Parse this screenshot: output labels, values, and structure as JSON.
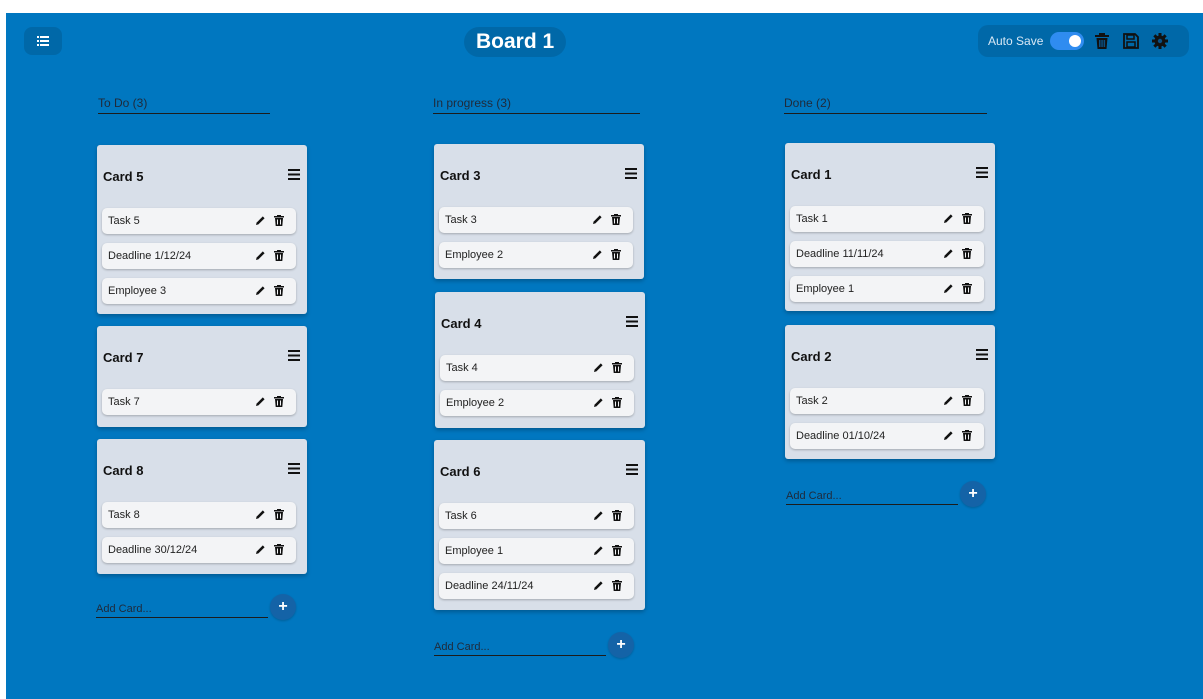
{
  "app": {
    "board_title": "Board 1"
  },
  "toolbar": {
    "autosave_label": "Auto Save",
    "autosave_enabled": true,
    "icons": [
      "list-icon",
      "trash-icon",
      "save-icon",
      "gear-icon"
    ]
  },
  "columns": [
    {
      "header": "To Do (3)",
      "add_placeholder": "Add Card...",
      "add_button": "+",
      "cards": [
        {
          "title": "Card 5",
          "items": [
            "Task 5",
            "Deadline 1/12/24",
            "Employee 3"
          ]
        },
        {
          "title": "Card 7",
          "items": [
            "Task 7"
          ]
        },
        {
          "title": "Card 8",
          "items": [
            "Task 8",
            "Deadline 30/12/24"
          ]
        }
      ]
    },
    {
      "header": "In progress (3)",
      "add_placeholder": "Add Card...",
      "add_button": "+",
      "cards": [
        {
          "title": "Card 3",
          "items": [
            "Task 3",
            "Employee 2"
          ]
        },
        {
          "title": "Card 4",
          "items": [
            "Task 4",
            "Employee 2"
          ]
        },
        {
          "title": "Card 6",
          "items": [
            "Task 6",
            "Employee 1",
            "Deadline 24/11/24"
          ]
        }
      ]
    },
    {
      "header": "Done (2)",
      "add_placeholder": "Add Card...",
      "add_button": "+",
      "cards": [
        {
          "title": "Card 1",
          "items": [
            "Task 1",
            "Deadline 11/11/24",
            "Employee 1"
          ]
        },
        {
          "title": "Card 2",
          "items": [
            "Task 2",
            "Deadline 01/10/24"
          ]
        }
      ]
    }
  ],
  "colors": {
    "board_background": "#0077c0",
    "card_background": "#d8dfe9",
    "item_background": "#f3f4f6",
    "add_button": "#1463a7",
    "toggle_on": "#2f8cf0"
  }
}
